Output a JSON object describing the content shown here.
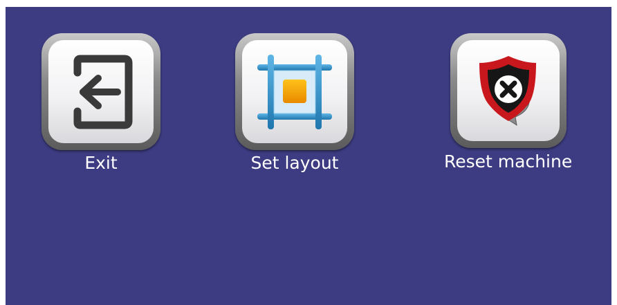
{
  "buttons": [
    {
      "id": "exit",
      "label": "Exit",
      "icon": "exit-arrow-icon"
    },
    {
      "id": "set_layout",
      "label": "Set layout",
      "icon": "layout-grid-icon"
    },
    {
      "id": "reset_machine",
      "label": "Reset machine",
      "icon": "shield-x-icon"
    }
  ],
  "colors": {
    "background": "#3d3c82",
    "label_text": "#ffffff",
    "layout_blue": "#2f8fc4",
    "layout_orange": "#f0a000",
    "shield_red": "#c8171d"
  }
}
